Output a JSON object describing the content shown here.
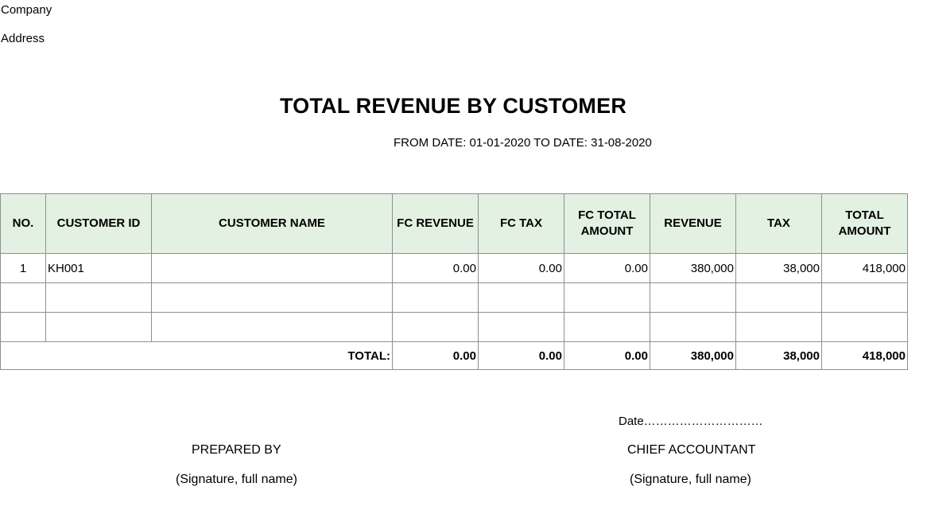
{
  "header": {
    "company": "Company",
    "address": "Address",
    "title": "TOTAL REVENUE BY CUSTOMER",
    "date_range": "FROM DATE: 01-01-2020 TO DATE: 31-08-2020"
  },
  "table": {
    "columns": [
      "NO.",
      "CUSTOMER ID",
      "CUSTOMER NAME",
      "FC REVENUE",
      "FC TAX",
      "FC TOTAL AMOUNT",
      "REVENUE",
      "TAX",
      "TOTAL AMOUNT"
    ],
    "rows": [
      [
        "1",
        "KH001",
        "",
        "0.00",
        "0.00",
        "0.00",
        "380,000",
        "38,000",
        "418,000"
      ],
      [
        "",
        "",
        "",
        "",
        "",
        "",
        "",
        "",
        ""
      ],
      [
        "",
        "",
        "",
        "",
        "",
        "",
        "",
        "",
        ""
      ]
    ],
    "total": {
      "label": "TOTAL:",
      "fc_revenue": "0.00",
      "fc_tax": "0.00",
      "fc_total_amount": "0.00",
      "revenue": "380,000",
      "tax": "38,000",
      "total_amount": "418,000"
    }
  },
  "signatures": {
    "date_line": "Date…………………………",
    "prepared_by": "PREPARED BY",
    "prepared_by_note": "(Signature, full name)",
    "chief_accountant": "CHIEF ACCOUNTANT",
    "chief_accountant_note": "(Signature, full name)"
  }
}
